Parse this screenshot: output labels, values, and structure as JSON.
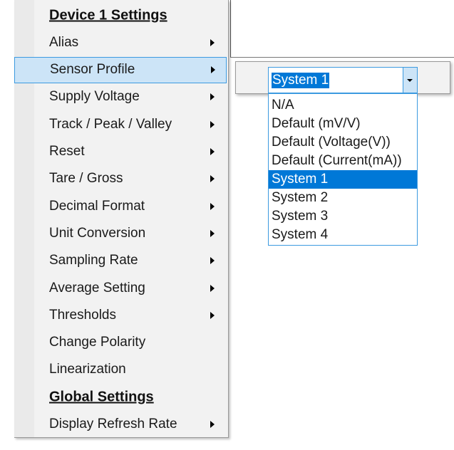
{
  "menu": {
    "items": [
      {
        "label": "Device 1 Settings",
        "type": "header",
        "arrow": false
      },
      {
        "label": "Alias",
        "arrow": true
      },
      {
        "label": "Sensor Profile",
        "arrow": true,
        "highlighted": true
      },
      {
        "label": "Supply Voltage",
        "arrow": true
      },
      {
        "label": "Track / Peak / Valley",
        "arrow": true
      },
      {
        "label": "Reset",
        "arrow": true
      },
      {
        "label": "Tare / Gross",
        "arrow": true
      },
      {
        "label": "Decimal Format",
        "arrow": true
      },
      {
        "label": "Unit Conversion",
        "arrow": true
      },
      {
        "label": "Sampling Rate",
        "arrow": true
      },
      {
        "label": "Average Setting",
        "arrow": true
      },
      {
        "label": "Thresholds",
        "arrow": true
      },
      {
        "label": "Change Polarity",
        "arrow": false
      },
      {
        "label": "Linearization",
        "arrow": false
      },
      {
        "label": "Global Settings",
        "type": "header",
        "arrow": false
      },
      {
        "label": "Display Refresh Rate",
        "arrow": true
      }
    ]
  },
  "sensor_profile": {
    "selected": "System 1",
    "options": [
      "N/A",
      "Default (mV/V)",
      "Default (Voltage(V))",
      "Default (Current(mA))",
      "System 1",
      "System 2",
      "System 3",
      "System 4"
    ]
  },
  "colors": {
    "highlight": "#cce4f7",
    "selection": "#0078d7",
    "border": "#3c9ae0"
  }
}
